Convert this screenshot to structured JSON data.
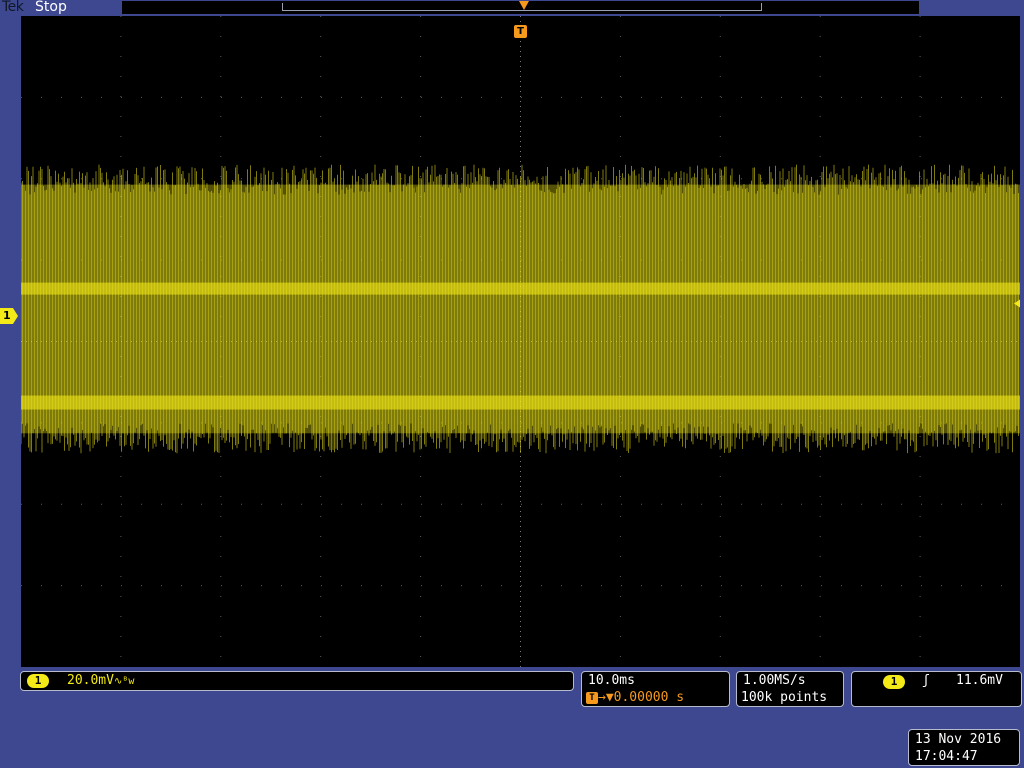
{
  "header": {
    "brand": "Tek",
    "run_state": "Stop"
  },
  "display": {
    "trace_color": "#f3ea17",
    "trigger_color": "#f59a1d",
    "background_color": "#000000",
    "bezel_color": "#3d4891",
    "divisions_horizontal": 10,
    "divisions_vertical": 8,
    "trigger_position_fraction": 0.5
  },
  "trigger_marker": {
    "icon": "T"
  },
  "channel": {
    "number": "1",
    "vertical_scale": "20.0mV",
    "bandwidth_icon": "∿ᴮw"
  },
  "timebase": {
    "scale": "10.0ms",
    "trigger_icon": "T",
    "delay_arrow": "→▼",
    "delay": "0.00000 s"
  },
  "acquisition": {
    "sample_rate": "1.00MS/s",
    "record_length": "100k points"
  },
  "trigger": {
    "source": "1",
    "slope_icon": "ʃ",
    "level": "11.6mV"
  },
  "timestamp": {
    "date": "13 Nov 2016",
    "time": "17:04:47"
  },
  "chart_data": {
    "type": "line",
    "title": "",
    "xlabel": "",
    "ylabel": "",
    "x_range_divisions": [
      -5,
      5
    ],
    "y_range_divisions": [
      -4,
      4
    ],
    "signal_band_divisions": [
      -1.3,
      2.1
    ],
    "signal_dense_bands_divisions": [
      -0.75,
      0.65
    ],
    "series": [
      {
        "name": "",
        "description_values": []
      }
    ],
    "grid": true
  }
}
